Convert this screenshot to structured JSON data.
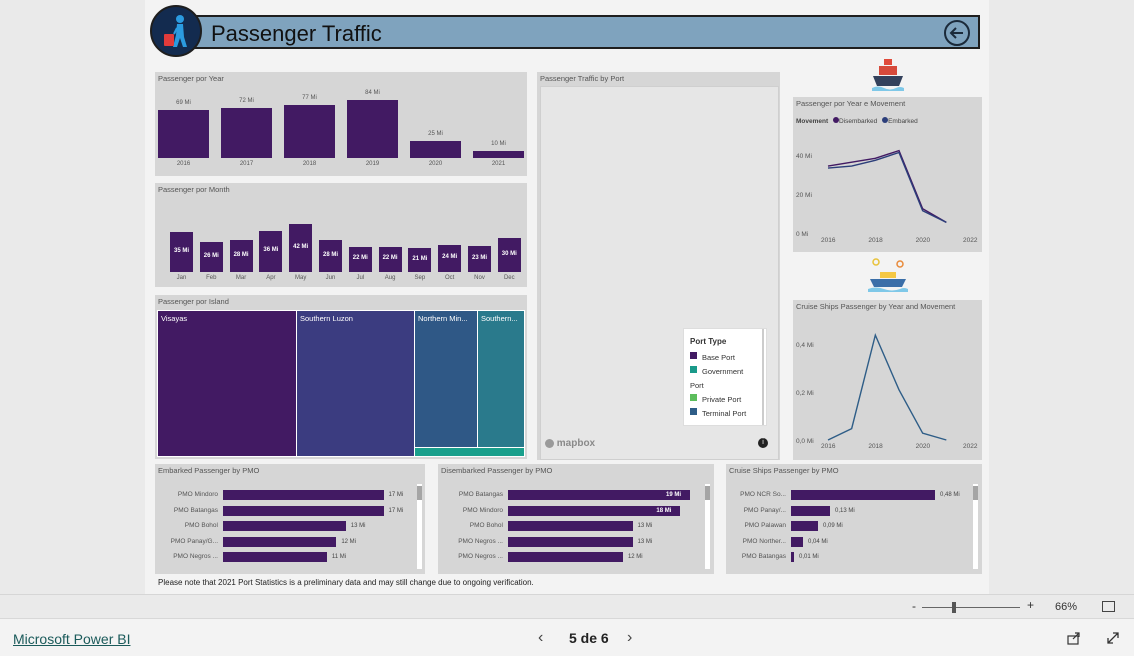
{
  "header": {
    "title": "Passenger Traffic"
  },
  "year_chart": {
    "title": "Passenger por Year",
    "chart_data": {
      "type": "bar",
      "categories": [
        "2016",
        "2017",
        "2018",
        "2019",
        "2020",
        "2021"
      ],
      "values": [
        69,
        72,
        77,
        84,
        25,
        10
      ],
      "labels": [
        "69 Mi",
        "72 Mi",
        "77 Mi",
        "84 Mi",
        "25 Mi",
        "10 Mi"
      ]
    }
  },
  "month_chart": {
    "title": "Passenger por Month",
    "chart_data": {
      "type": "bar",
      "categories": [
        "Jan",
        "Feb",
        "Mar",
        "Apr",
        "May",
        "Jun",
        "Jul",
        "Aug",
        "Sep",
        "Oct",
        "Nov",
        "Dec"
      ],
      "values": [
        35,
        26,
        28,
        36,
        42,
        28,
        22,
        22,
        21,
        24,
        23,
        30
      ],
      "labels": [
        "35 Mi",
        "26 Mi",
        "28 Mi",
        "36 Mi",
        "42 Mi",
        "28 Mi",
        "22 Mi",
        "22 Mi",
        "21 Mi",
        "24 Mi",
        "23 Mi",
        "30 Mi"
      ]
    }
  },
  "island_chart": {
    "title": "Passenger por Island",
    "tiles": [
      "Visayas",
      "Southern Luzon",
      "Northern Min...",
      "Southern..."
    ]
  },
  "map": {
    "title": "Passenger Traffic by Port",
    "attribution": "mapbox",
    "info": "i",
    "legend": {
      "title": "Port Type",
      "items": [
        {
          "label": "Base Port",
          "color": "#421a63"
        },
        {
          "label": "Government Port",
          "color": "#1a9a8a"
        },
        {
          "label": "Private Port",
          "color": "#5cbd5c"
        },
        {
          "label": "Terminal Port",
          "color": "#2e5d87"
        }
      ]
    }
  },
  "movement_chart": {
    "title": "Passenger por Year e Movement",
    "legend_title": "Movement",
    "chart_data": {
      "type": "line",
      "x": [
        2016,
        2017,
        2018,
        2019,
        2020,
        2021
      ],
      "series": [
        {
          "name": "Disembarked",
          "values": [
            35,
            37,
            39,
            43,
            13,
            6
          ]
        },
        {
          "name": "Embarked",
          "values": [
            34,
            35,
            38,
            42,
            12,
            6
          ]
        }
      ],
      "yticks": [
        "40 Mi",
        "20 Mi",
        "0 Mi"
      ],
      "xticks": [
        "2016",
        "2018",
        "2020",
        "2022"
      ],
      "ylim": [
        0,
        50
      ],
      "xlim": [
        2016,
        2022
      ],
      "colors": [
        "#421a63",
        "#2c3e7a"
      ]
    }
  },
  "cruise_chart": {
    "title": "Cruise Ships Passenger by Year and Movement",
    "chart_data": {
      "type": "line",
      "x": [
        2016,
        2017,
        2018,
        2019,
        2020,
        2021
      ],
      "series": [
        {
          "values": [
            0.0,
            0.05,
            0.46,
            0.22,
            0.03,
            0.0
          ]
        }
      ],
      "yticks": [
        "0,4 Mi",
        "0,2 Mi",
        "0,0 Mi"
      ],
      "xticks": [
        "2016",
        "2018",
        "2020",
        "2022"
      ],
      "ylim": [
        0,
        0.5
      ],
      "xlim": [
        2016,
        2022
      ],
      "colors": [
        "#2e5d87"
      ]
    }
  },
  "embarked_pmo": {
    "title": "Embarked Passenger by PMO",
    "chart_data": {
      "type": "bar",
      "orientation": "horizontal",
      "categories": [
        "PMO Mindoro",
        "PMO Batangas",
        "PMO Bohol",
        "PMO Panay/G...",
        "PMO Negros ..."
      ],
      "values": [
        17,
        17,
        13,
        12,
        11
      ],
      "labels": [
        "17 Mi",
        "17 Mi",
        "13 Mi",
        "12 Mi",
        "11 Mi"
      ],
      "xmax": 18
    }
  },
  "disembarked_pmo": {
    "title": "Disembarked Passenger by PMO",
    "chart_data": {
      "type": "bar",
      "orientation": "horizontal",
      "categories": [
        "PMO Batangas",
        "PMO Mindoro",
        "PMO Bohol",
        "PMO Negros ...",
        "PMO Negros ..."
      ],
      "values": [
        19,
        18,
        13,
        13,
        12
      ],
      "labels": [
        "19 Mi",
        "18 Mi",
        "13 Mi",
        "13 Mi",
        "12 Mi"
      ],
      "xmax": 19
    }
  },
  "cruise_pmo": {
    "title": "Cruise Ships Passenger by PMO",
    "chart_data": {
      "type": "bar",
      "orientation": "horizontal",
      "categories": [
        "PMO NCR So...",
        "PMO Panay/...",
        "PMO Palawan",
        "PMO Norther...",
        "PMO Batangas"
      ],
      "values": [
        0.48,
        0.13,
        0.09,
        0.04,
        0.01
      ],
      "labels": [
        "0,48 Mi",
        "0,13 Mi",
        "0,09 Mi",
        "0,04 Mi",
        "0,01 Mi"
      ],
      "xmax": 0.48
    }
  },
  "note": "Please note that 2021 Port Statistics is a preliminary data and may still change due to ongoing verification.",
  "zoom": {
    "value": "66%",
    "minus": "-",
    "plus": "+"
  },
  "footer": {
    "brand": "Microsoft Power BI",
    "page": "5 de 6"
  }
}
